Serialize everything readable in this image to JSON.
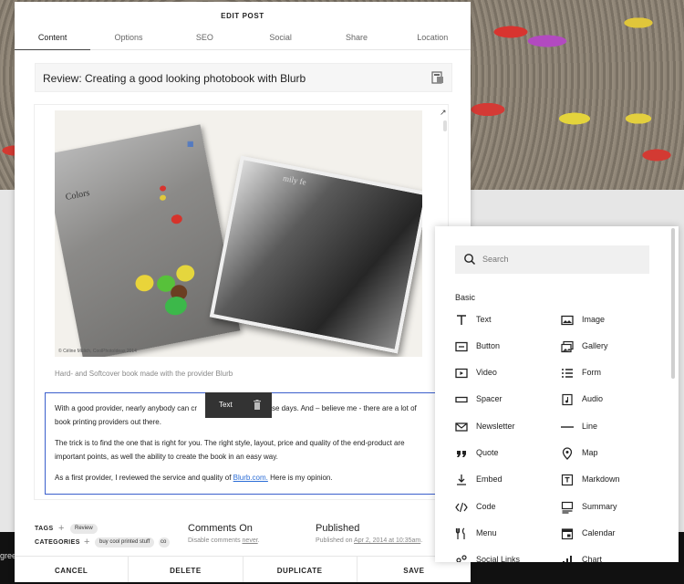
{
  "background": {
    "footer_text": "gree"
  },
  "panel": {
    "title": "EDIT POST",
    "tabs": [
      "Content",
      "Options",
      "SEO",
      "Social",
      "Share",
      "Location"
    ],
    "post_title": "Review: Creating a good looking photobook with Blurb",
    "photo": {
      "book1_title": "Colors",
      "book2_title": "mily fe",
      "credit": "© Céline Mülich, CoolPhotoIdeas 2014"
    },
    "caption": "Hard- and Softcover book made with the provider Blurb",
    "text_toolbar": {
      "label": "Text"
    },
    "paragraphs": {
      "p1": "With a good provider, nearly anybody can cr",
      "p1b": "hese days. And – believe me - there are a lot of book printing providers out there.",
      "p2": "The trick is to find the one that is right for you. The right style, layout, price and quality of the end-product are important points, as well the ability to create the book in an easy way.",
      "p3_before": "As a first provider, I reviewed the service and quality of ",
      "p3_link": "Blurb.com.",
      "p3_after": " Here is my opinion."
    },
    "meta": {
      "tags_label": "TAGS",
      "tags": [
        "Review"
      ],
      "categories_label": "CATEGORIES",
      "categories": [
        "buy cool printed stuff",
        "co"
      ],
      "comments_title": "Comments On",
      "comments_sub_before": "Disable comments ",
      "comments_sub_link": "never",
      "comments_sub_after": ".",
      "published_title": "Published",
      "published_sub_before": "Published on ",
      "published_sub_link": "Apr 2, 2014 at 10:35am",
      "published_sub_after": "."
    },
    "footer": [
      "CANCEL",
      "DELETE",
      "DUPLICATE",
      "SAVE"
    ]
  },
  "picker": {
    "search_placeholder": "Search",
    "section": "Basic",
    "items": [
      {
        "label": "Text",
        "icon": "text-icon"
      },
      {
        "label": "Image",
        "icon": "image-icon"
      },
      {
        "label": "Button",
        "icon": "button-icon"
      },
      {
        "label": "Gallery",
        "icon": "gallery-icon"
      },
      {
        "label": "Video",
        "icon": "video-icon"
      },
      {
        "label": "Form",
        "icon": "form-icon"
      },
      {
        "label": "Spacer",
        "icon": "spacer-icon"
      },
      {
        "label": "Audio",
        "icon": "audio-icon"
      },
      {
        "label": "Newsletter",
        "icon": "newsletter-icon"
      },
      {
        "label": "Line",
        "icon": "line-icon"
      },
      {
        "label": "Quote",
        "icon": "quote-icon"
      },
      {
        "label": "Map",
        "icon": "map-icon"
      },
      {
        "label": "Embed",
        "icon": "embed-icon"
      },
      {
        "label": "Markdown",
        "icon": "markdown-icon"
      },
      {
        "label": "Code",
        "icon": "code-icon"
      },
      {
        "label": "Summary",
        "icon": "summary-icon"
      },
      {
        "label": "Menu",
        "icon": "menu-icon"
      },
      {
        "label": "Calendar",
        "icon": "calendar-icon"
      },
      {
        "label": "Social Links",
        "icon": "social-links-icon"
      },
      {
        "label": "Chart",
        "icon": "chart-icon"
      }
    ]
  }
}
